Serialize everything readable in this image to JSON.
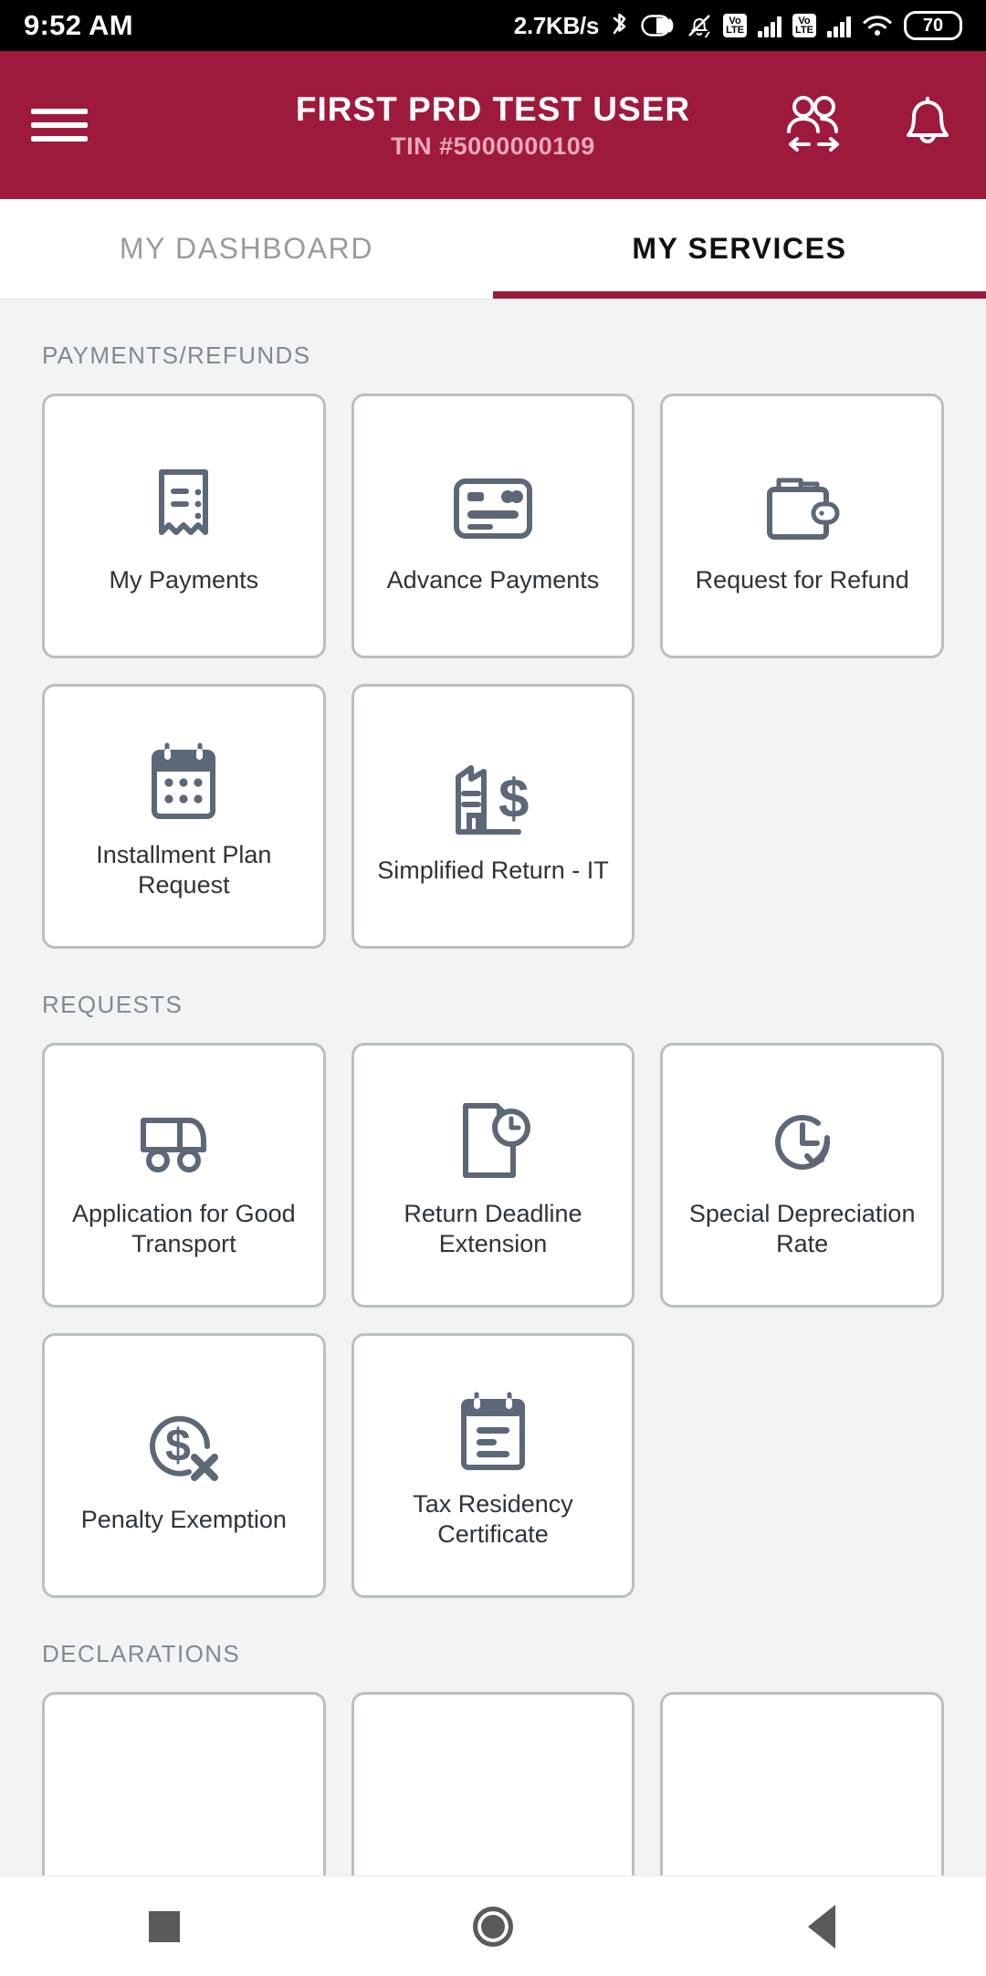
{
  "status_bar": {
    "clock": "9:52 AM",
    "network_speed": "2.7KB/s",
    "volte_top": "Vo",
    "volte_bottom": "LTE",
    "battery": "70",
    "icons": [
      "bluetooth-icon",
      "data-saver-icon",
      "mute-icon",
      "volte-icon",
      "signal-icon",
      "volte-icon",
      "signal-icon",
      "wifi-icon",
      "battery-icon"
    ]
  },
  "header": {
    "title": "FIRST PRD TEST USER",
    "subtitle": "TIN #5000000109",
    "menu_icon": "hamburger-menu-icon",
    "switch_user_icon": "switch-user-icon",
    "notification_icon": "bell-icon",
    "brand_color": "#9e1a3c"
  },
  "tabs": [
    {
      "label": "MY DASHBOARD",
      "active": false
    },
    {
      "label": "MY SERVICES",
      "active": true
    }
  ],
  "sections": [
    {
      "title": "PAYMENTS/REFUNDS",
      "cards": [
        {
          "label": "My Payments",
          "icon": "receipt-icon"
        },
        {
          "label": "Advance Payments",
          "icon": "credit-card-icon"
        },
        {
          "label": "Request for Refund",
          "icon": "wallet-icon"
        },
        {
          "label": "Installment Plan Request",
          "icon": "calendar-dots-icon"
        },
        {
          "label": "Simplified Return - IT",
          "icon": "building-dollar-icon"
        }
      ]
    },
    {
      "title": "REQUESTS",
      "cards": [
        {
          "label": "Application for Good Transport",
          "icon": "truck-icon"
        },
        {
          "label": "Return Deadline Extension",
          "icon": "document-clock-icon"
        },
        {
          "label": "Special Depreciation Rate",
          "icon": "clock-rotate-icon"
        },
        {
          "label": "Penalty Exemption",
          "icon": "dollar-cancel-icon"
        },
        {
          "label": "Tax Residency Certificate",
          "icon": "clipboard-lines-icon"
        }
      ]
    },
    {
      "title": "DECLARATIONS",
      "cards": [
        {
          "label": "",
          "icon": ""
        },
        {
          "label": "",
          "icon": ""
        },
        {
          "label": "",
          "icon": ""
        }
      ]
    }
  ],
  "bottom_nav": [
    {
      "name": "recents-button",
      "icon": "square-icon"
    },
    {
      "name": "home-button",
      "icon": "circle-icon"
    },
    {
      "name": "back-button",
      "icon": "triangle-left-icon"
    }
  ]
}
